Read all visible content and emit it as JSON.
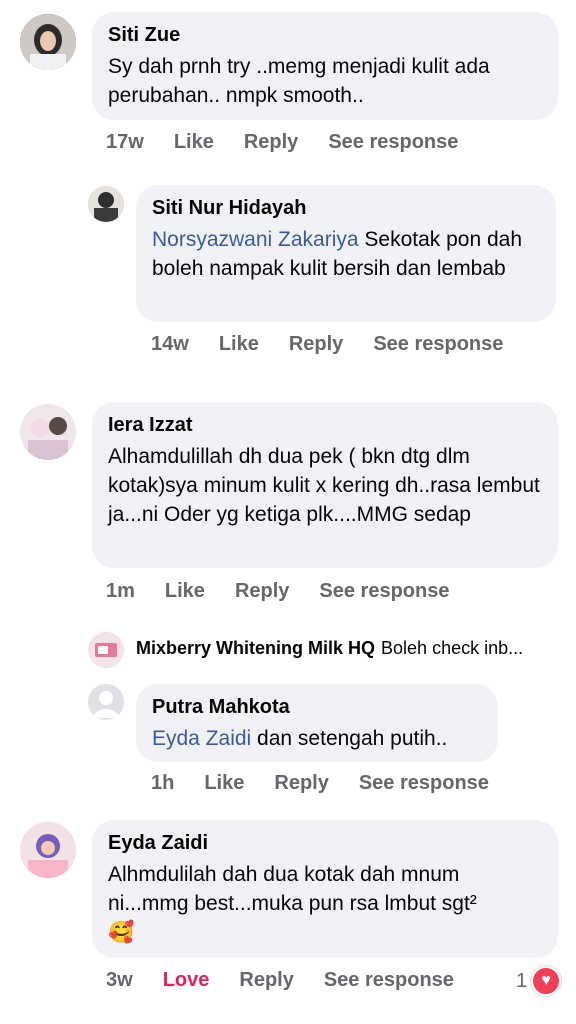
{
  "comments": [
    {
      "name": "Siti Zue",
      "text": "Sy dah prnh try ..memg menjadi kulit ada perubahan.. nmpk smooth..",
      "time": "17w",
      "like": "Like",
      "reply": "Reply",
      "see": "See response"
    },
    {
      "name": "Siti Nur Hidayah",
      "mention": "Norsyazwani Zakariya",
      "text": " Sekotak pon dah boleh nampak kulit bersih dan lembab",
      "time": "14w",
      "like": "Like",
      "reply": "Reply",
      "see": "See response"
    },
    {
      "name": "Iera Izzat",
      "text": "Alhamdulillah dh dua pek  ( bkn dtg dlm kotak)sya minum kulit x kering dh..rasa lembut ja...ni Oder yg ketiga plk....MMG sedap",
      "time": "1m",
      "like": "Like",
      "reply": "Reply",
      "see": "See response"
    },
    {
      "name": "Mixberry Whitening Milk HQ",
      "text": "Boleh check inb..."
    },
    {
      "name": "Putra Mahkota",
      "mention": "Eyda Zaidi",
      "text": " dan setengah putih..",
      "time": "1h",
      "like": "Like",
      "reply": "Reply",
      "see": "See response"
    },
    {
      "name": "Eyda Zaidi",
      "text": "Alhmdulilah dah dua kotak dah mnum ni...mmg best...muka pun rsa lmbut sgt²",
      "emoji": "🥰",
      "time": "3w",
      "love": "Love",
      "reply": "Reply",
      "see": "See response",
      "reaction_count": "1"
    }
  ],
  "colors": {
    "bubble": "#f0f2f5",
    "mention": "#3a5ba0",
    "meta": "#65676b",
    "love": "#e0245e",
    "heart": "#f33e58"
  }
}
